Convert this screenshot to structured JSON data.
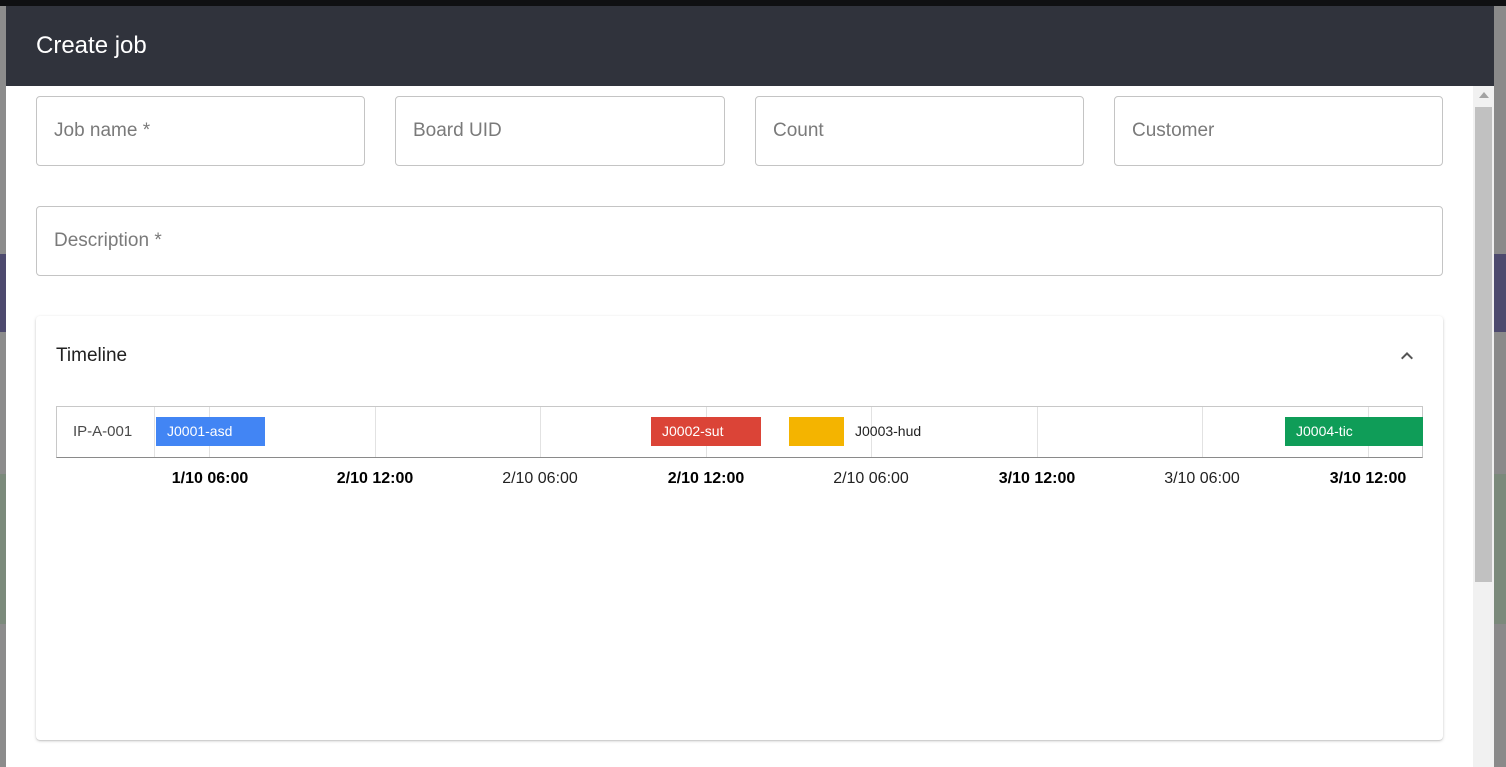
{
  "modal": {
    "title": "Create job"
  },
  "form": {
    "job_name": {
      "placeholder": "Job name *",
      "value": ""
    },
    "board_uid": {
      "placeholder": "Board UID",
      "value": ""
    },
    "count": {
      "placeholder": "Count",
      "value": ""
    },
    "customer": {
      "placeholder": "Customer",
      "value": ""
    },
    "description": {
      "placeholder": "Description *",
      "value": ""
    }
  },
  "timeline_panel": {
    "title": "Timeline",
    "collapse_icon": "chevron-up-icon",
    "expanded": true
  },
  "timeline": {
    "rows": [
      {
        "label": "IP-A-001",
        "jobs": [
          {
            "label": "J0001-asd",
            "color": "#4285f4"
          },
          {
            "label": "J0002-sut",
            "color": "#db4437"
          },
          {
            "label": "J0003-hud",
            "color": "#f4b400"
          },
          {
            "label": "J0004-tic",
            "color": "#0f9d58"
          }
        ]
      }
    ],
    "ticks": [
      {
        "label": "1/10 06:00",
        "bold": true
      },
      {
        "label": "2/10 12:00",
        "bold": true
      },
      {
        "label": "2/10 06:00",
        "bold": false
      },
      {
        "label": "2/10 12:00",
        "bold": true
      },
      {
        "label": "2/10 06:00",
        "bold": false
      },
      {
        "label": "3/10 12:00",
        "bold": true
      },
      {
        "label": "3/10 06:00",
        "bold": false
      },
      {
        "label": "3/10 12:00",
        "bold": true
      }
    ]
  }
}
